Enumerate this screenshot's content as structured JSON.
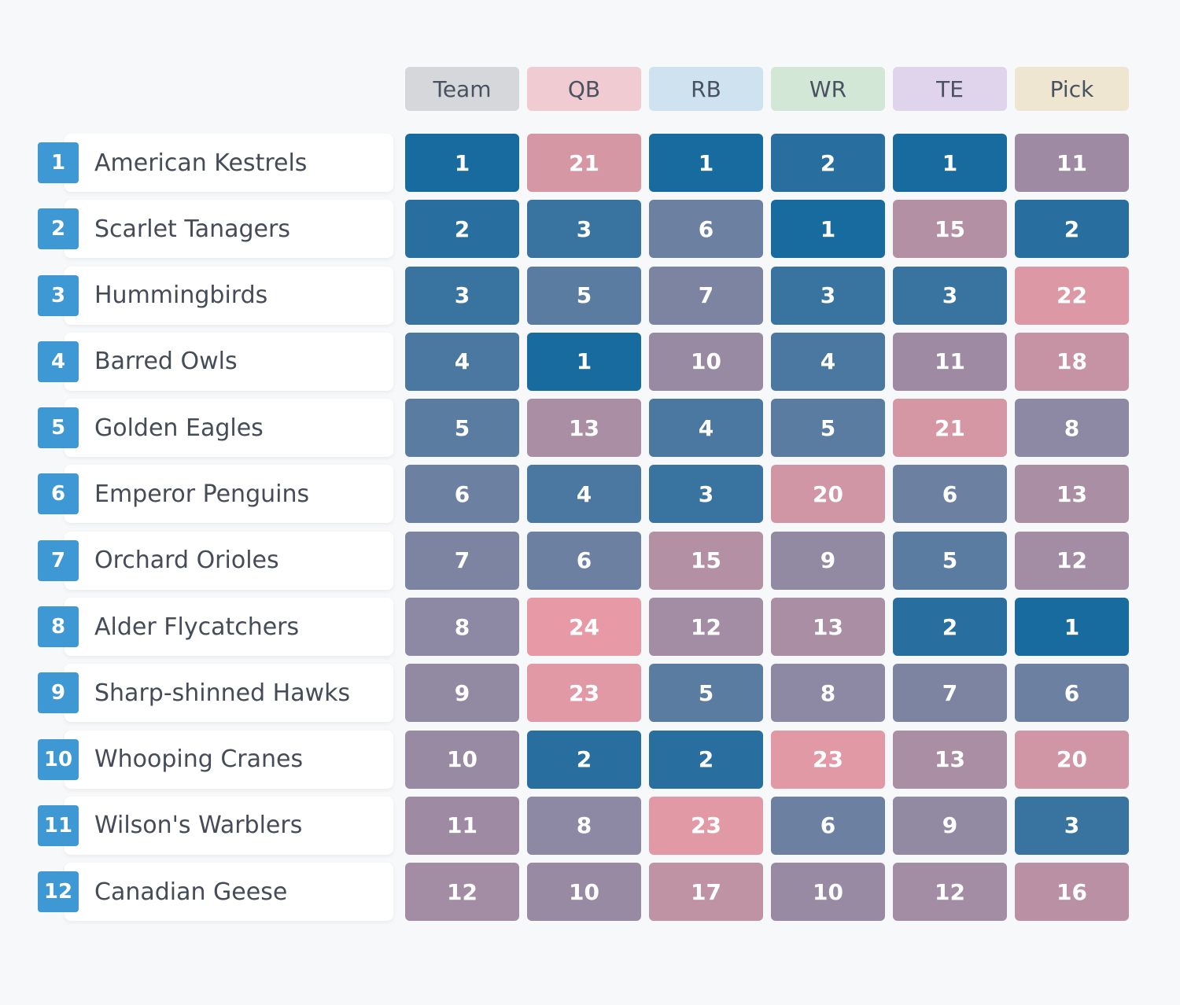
{
  "chart_data": {
    "type": "heatmap",
    "title": "",
    "columns": [
      "Team",
      "QB",
      "RB",
      "WR",
      "TE",
      "Pick"
    ],
    "column_colors": [
      "#d5d7db",
      "#f1cbd2",
      "#cfe2ef",
      "#d2e7d6",
      "#e0d3ec",
      "#eee6d1"
    ],
    "rows": [
      {
        "rank": "1",
        "team": "American Kestrels",
        "values": [
          1,
          21,
          1,
          2,
          1,
          11
        ]
      },
      {
        "rank": "2",
        "team": "Scarlet Tanagers",
        "values": [
          2,
          3,
          6,
          1,
          15,
          2
        ]
      },
      {
        "rank": "3",
        "team": "Hummingbirds",
        "values": [
          3,
          5,
          7,
          3,
          3,
          22
        ]
      },
      {
        "rank": "4",
        "team": "Barred Owls",
        "values": [
          4,
          1,
          10,
          4,
          11,
          18
        ]
      },
      {
        "rank": "5",
        "team": "Golden Eagles",
        "values": [
          5,
          13,
          4,
          5,
          21,
          8
        ]
      },
      {
        "rank": "6",
        "team": "Emperor Penguins",
        "values": [
          6,
          4,
          3,
          20,
          6,
          13
        ]
      },
      {
        "rank": "7",
        "team": "Orchard Orioles",
        "values": [
          7,
          6,
          15,
          9,
          5,
          12
        ]
      },
      {
        "rank": "8",
        "team": "Alder Flycatchers",
        "values": [
          8,
          24,
          12,
          13,
          2,
          1
        ]
      },
      {
        "rank": "9",
        "team": "Sharp-shinned Hawks",
        "values": [
          9,
          23,
          5,
          8,
          7,
          6
        ]
      },
      {
        "rank": "10",
        "team": "Whooping Cranes",
        "values": [
          10,
          2,
          2,
          23,
          13,
          20
        ]
      },
      {
        "rank": "11",
        "team": "Wilson's Warblers",
        "values": [
          11,
          8,
          23,
          6,
          9,
          3
        ]
      },
      {
        "rank": "12",
        "team": "Canadian Geese",
        "values": [
          12,
          10,
          17,
          10,
          12,
          16
        ]
      }
    ],
    "color_scale": {
      "low": "#176b9e",
      "mid": "#8c88a3",
      "high": "#e79aa5",
      "domain": [
        1,
        24
      ]
    }
  }
}
